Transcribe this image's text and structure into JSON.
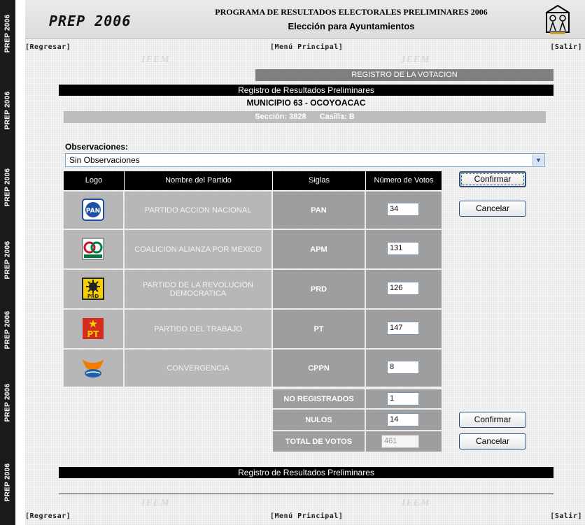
{
  "strip": {
    "label": "PREP 2006"
  },
  "header": {
    "logo": "PREP 2006",
    "title": "PROGRAMA DE RESULTADOS ELECTORALES PRELIMINARES 2006",
    "subtitle": "Elección para Ayuntamientos"
  },
  "nav": {
    "back": "[Regresar]",
    "menu": "[Menú Principal]",
    "exit": "[Salir]"
  },
  "watermark": "IEEM",
  "section_title": "REGISTRO DE LA VOTACION",
  "banner": "Registro de Resultados Preliminares",
  "municipio": "MUNICIPIO 63 - OCOYOACAC",
  "seccion": {
    "seccion": "Sección: 3828",
    "casilla": "Casilla: B"
  },
  "observaciones": {
    "label": "Observaciones:",
    "selected": "Sin Observaciones"
  },
  "table": {
    "headers": {
      "logo": "Logo",
      "name": "Nombre del Partido",
      "siglas": "Siglas",
      "votos": "Número de Votos"
    },
    "parties": [
      {
        "name": "PARTIDO ACCION NACIONAL",
        "siglas": "PAN",
        "votes": "34",
        "logo_icon": "pan-logo-icon",
        "color": "#1f4fa3"
      },
      {
        "name": "COALICION ALIANZA POR MEXICO",
        "siglas": "APM",
        "votes": "131",
        "logo_icon": "apm-logo-icon",
        "color": "#c8102e"
      },
      {
        "name": "PARTIDO DE LA REVOLUCION DEMOCRATICA",
        "siglas": "PRD",
        "votes": "126",
        "logo_icon": "prd-logo-icon",
        "color": "#f7d000"
      },
      {
        "name": "PARTIDO DEL TRABAJO",
        "siglas": "PT",
        "votes": "147",
        "logo_icon": "pt-logo-icon",
        "color": "#d52b1e"
      },
      {
        "name": "CONVERGENCIA",
        "siglas": "CPPN",
        "votes": "8",
        "logo_icon": "convergencia-logo-icon",
        "color": "#f07d00"
      }
    ],
    "totals": [
      {
        "label": "NO REGISTRADOS",
        "value": "1"
      },
      {
        "label": "NULOS",
        "value": "14"
      },
      {
        "label": "TOTAL DE VOTOS",
        "value": "461"
      }
    ]
  },
  "buttons": {
    "confirm": "Confirmar",
    "cancel": "Cancelar"
  }
}
